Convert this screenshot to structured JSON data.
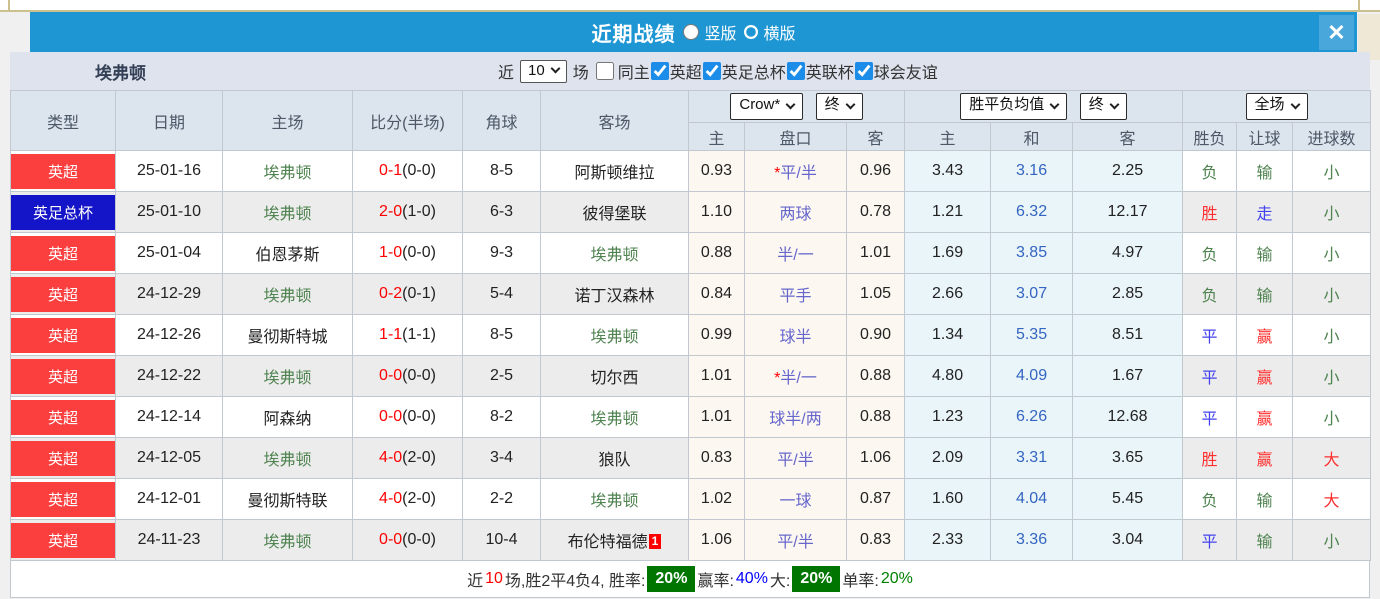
{
  "header": {
    "title": "近期战绩",
    "radio_vertical": "竖版",
    "radio_horizontal": "横版",
    "vertical_checked": false,
    "horizontal_checked": true,
    "close_glyph": "✕"
  },
  "filter": {
    "team": "埃弗顿",
    "near_label": "近",
    "near_value": "10",
    "games_label": "场",
    "same_home_label": "同主",
    "same_home_checked": false,
    "leagues": [
      {
        "label": "英超",
        "checked": true
      },
      {
        "label": "英足总杯",
        "checked": true
      },
      {
        "label": "英联杯",
        "checked": true
      },
      {
        "label": "球会友谊",
        "checked": true
      }
    ]
  },
  "table": {
    "static_headers": [
      "类型",
      "日期",
      "主场",
      "比分(半场)",
      "角球",
      "客场"
    ],
    "group1": {
      "select1": "Crow*",
      "select2": "终",
      "cols": [
        "主",
        "盘口",
        "客"
      ]
    },
    "group2": {
      "select1": "胜平负均值",
      "select2": "终",
      "cols": [
        "主",
        "和",
        "客"
      ]
    },
    "group3": {
      "select": "全场",
      "cols": [
        "胜负",
        "让球",
        "进球数"
      ]
    },
    "rows": [
      {
        "league": "英超",
        "league_color": "red",
        "date": "25-01-16",
        "home": "埃弗顿",
        "home_is_team": true,
        "score": "0-1",
        "half": "(0-0)",
        "corners": "8-5",
        "away": "阿斯顿维拉",
        "away_is_team": false,
        "away_badge": "",
        "crow_home": "0.93",
        "handicap": "平/半",
        "star": true,
        "crow_away": "0.96",
        "avg_home": "3.43",
        "avg_draw": "3.16",
        "avg_away": "2.25",
        "result": "负",
        "let_result": "输",
        "goals": "小"
      },
      {
        "league": "英足总杯",
        "league_color": "blue",
        "date": "25-01-10",
        "home": "埃弗顿",
        "home_is_team": true,
        "score": "2-0",
        "half": "(1-0)",
        "corners": "6-3",
        "away": "彼得堡联",
        "away_is_team": false,
        "away_badge": "",
        "crow_home": "1.10",
        "handicap": "两球",
        "star": false,
        "crow_away": "0.78",
        "avg_home": "1.21",
        "avg_draw": "6.32",
        "avg_away": "12.17",
        "result": "胜",
        "let_result": "走",
        "goals": "小"
      },
      {
        "league": "英超",
        "league_color": "red",
        "date": "25-01-04",
        "home": "伯恩茅斯",
        "home_is_team": false,
        "score": "1-0",
        "half": "(0-0)",
        "corners": "9-3",
        "away": "埃弗顿",
        "away_is_team": true,
        "away_badge": "",
        "crow_home": "0.88",
        "handicap": "半/一",
        "star": false,
        "crow_away": "1.01",
        "avg_home": "1.69",
        "avg_draw": "3.85",
        "avg_away": "4.97",
        "result": "负",
        "let_result": "输",
        "goals": "小"
      },
      {
        "league": "英超",
        "league_color": "red",
        "date": "24-12-29",
        "home": "埃弗顿",
        "home_is_team": true,
        "score": "0-2",
        "half": "(0-1)",
        "corners": "5-4",
        "away": "诺丁汉森林",
        "away_is_team": false,
        "away_badge": "",
        "crow_home": "0.84",
        "handicap": "平手",
        "star": false,
        "crow_away": "1.05",
        "avg_home": "2.66",
        "avg_draw": "3.07",
        "avg_away": "2.85",
        "result": "负",
        "let_result": "输",
        "goals": "小"
      },
      {
        "league": "英超",
        "league_color": "red",
        "date": "24-12-26",
        "home": "曼彻斯特城",
        "home_is_team": false,
        "score": "1-1",
        "half": "(1-1)",
        "corners": "8-5",
        "away": "埃弗顿",
        "away_is_team": true,
        "away_badge": "",
        "crow_home": "0.99",
        "handicap": "球半",
        "star": false,
        "crow_away": "0.90",
        "avg_home": "1.34",
        "avg_draw": "5.35",
        "avg_away": "8.51",
        "result": "平",
        "let_result": "赢",
        "goals": "小"
      },
      {
        "league": "英超",
        "league_color": "red",
        "date": "24-12-22",
        "home": "埃弗顿",
        "home_is_team": true,
        "score": "0-0",
        "half": "(0-0)",
        "corners": "2-5",
        "away": "切尔西",
        "away_is_team": false,
        "away_badge": "",
        "crow_home": "1.01",
        "handicap": "半/一",
        "star": true,
        "crow_away": "0.88",
        "avg_home": "4.80",
        "avg_draw": "4.09",
        "avg_away": "1.67",
        "result": "平",
        "let_result": "赢",
        "goals": "小"
      },
      {
        "league": "英超",
        "league_color": "red",
        "date": "24-12-14",
        "home": "阿森纳",
        "home_is_team": false,
        "score": "0-0",
        "half": "(0-0)",
        "corners": "8-2",
        "away": "埃弗顿",
        "away_is_team": true,
        "away_badge": "",
        "crow_home": "1.01",
        "handicap": "球半/两",
        "star": false,
        "crow_away": "0.88",
        "avg_home": "1.23",
        "avg_draw": "6.26",
        "avg_away": "12.68",
        "result": "平",
        "let_result": "赢",
        "goals": "小"
      },
      {
        "league": "英超",
        "league_color": "red",
        "date": "24-12-05",
        "home": "埃弗顿",
        "home_is_team": true,
        "score": "4-0",
        "half": "(2-0)",
        "corners": "3-4",
        "away": "狼队",
        "away_is_team": false,
        "away_badge": "",
        "crow_home": "0.83",
        "handicap": "平/半",
        "star": false,
        "crow_away": "1.06",
        "avg_home": "2.09",
        "avg_draw": "3.31",
        "avg_away": "3.65",
        "result": "胜",
        "let_result": "赢",
        "goals": "大"
      },
      {
        "league": "英超",
        "league_color": "red",
        "date": "24-12-01",
        "home": "曼彻斯特联",
        "home_is_team": false,
        "score": "4-0",
        "half": "(2-0)",
        "corners": "2-2",
        "away": "埃弗顿",
        "away_is_team": true,
        "away_badge": "",
        "crow_home": "1.02",
        "handicap": "一球",
        "star": false,
        "crow_away": "0.87",
        "avg_home": "1.60",
        "avg_draw": "4.04",
        "avg_away": "5.45",
        "result": "负",
        "let_result": "输",
        "goals": "大"
      },
      {
        "league": "英超",
        "league_color": "red",
        "date": "24-11-23",
        "home": "埃弗顿",
        "home_is_team": true,
        "score": "0-0",
        "half": "(0-0)",
        "corners": "10-4",
        "away": "布伦特福德",
        "away_is_team": false,
        "away_badge": "1",
        "crow_home": "1.06",
        "handicap": "平/半",
        "star": false,
        "crow_away": "0.83",
        "avg_home": "2.33",
        "avg_draw": "3.36",
        "avg_away": "3.04",
        "result": "平",
        "let_result": "输",
        "goals": "小"
      }
    ],
    "value_classes": {
      "胜": "red",
      "平": "blue",
      "负": "green",
      "赢": "red",
      "走": "blue",
      "输": "green",
      "大": "red",
      "小": "green"
    }
  },
  "summary": {
    "parts": [
      {
        "text": "近",
        "style": "dark"
      },
      {
        "text": "10",
        "style": "red"
      },
      {
        "text": "场,胜2平4负4, 胜率:",
        "style": "dark"
      },
      {
        "text": "20%",
        "style": "badge"
      },
      {
        "text": "赢率:",
        "style": "dark"
      },
      {
        "text": "40%",
        "style": "blue"
      },
      {
        "text": "大:",
        "style": "dark"
      },
      {
        "text": "20%",
        "style": "badge"
      },
      {
        "text": "单率:",
        "style": "dark"
      },
      {
        "text": "20%",
        "style": "green"
      }
    ]
  },
  "colors": {
    "titlebar_blue": "#1e96d3",
    "close_button_blue": "#4aa7db",
    "filterbar_bg": "#dee3ed",
    "header_bg": "#dce4ee",
    "league_red": "#fb3e3e",
    "cup_blue": "#1414c8",
    "team_green": "#4f8350",
    "handicap_purple": "#6666cc",
    "avg_draw_blue": "#3465c0",
    "win_red": "#ff2f2f",
    "draw_blue": "#4343f0",
    "lose_green": "#4f8350",
    "badge_green": "#007500",
    "stripe_gray": "#ececec",
    "crow_bg": "#fcf8f1",
    "avg_bg": "#eaf5fa"
  }
}
